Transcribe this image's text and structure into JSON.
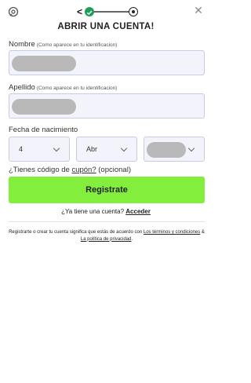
{
  "header": {
    "title": "ABRIR UNA CUENTA!",
    "back_glyph": "<",
    "close_glyph": "✕"
  },
  "form": {
    "nombre": {
      "label": "Nombre",
      "hint": "(Como aparece en tu identificacion)"
    },
    "apellido": {
      "label": "Apellido",
      "hint": "(Como aparece en tu identificacion)"
    },
    "fecha": {
      "label": "Fecha de nacimiento",
      "day": "4",
      "month": "Abr"
    },
    "coupon": {
      "prefix": "¿Tienes código de ",
      "link": "cupón?",
      "suffix": " (opcional)"
    },
    "submit_label": "Registrate"
  },
  "login": {
    "prompt": "¿Ya tiene una cuenta? ",
    "link": "Acceder"
  },
  "legal": {
    "prefix": "Registrarte o crear tu cuenta significa que estás de acuerdo con ",
    "terms_link": "Los términos y condiciones",
    "joiner": " & ",
    "privacy_link": "La política de privacidad",
    "suffix": "."
  },
  "colors": {
    "accent_green": "#84ee3c",
    "step_done": "#1e9e5a",
    "input_bg": "#f3f4fb",
    "input_border": "#c7cbe3"
  }
}
